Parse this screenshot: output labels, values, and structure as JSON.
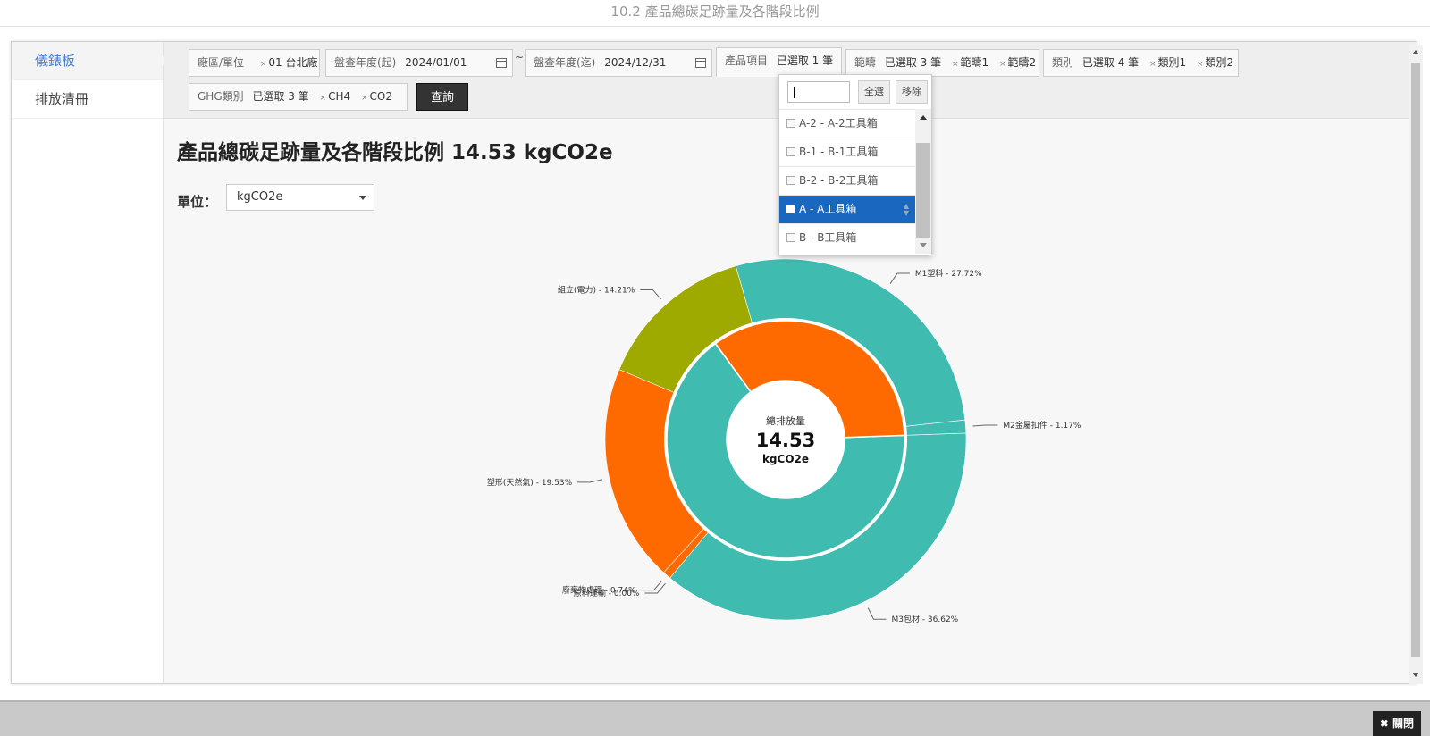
{
  "window": {
    "title": "10.2 產品總碳足跡量及各階段比例"
  },
  "sidebar": {
    "items": [
      {
        "label": "儀錶板"
      },
      {
        "label": "排放清冊"
      }
    ]
  },
  "filters": {
    "site": {
      "label": "廠區/單位",
      "chip": "01 台北廠"
    },
    "year_start": {
      "label": "盤查年度(起)",
      "value": "2024/01/01"
    },
    "tilde": "~",
    "year_end": {
      "label": "盤查年度(迄)",
      "value": "2024/12/31"
    },
    "product": {
      "label": "產品項目",
      "value": "已選取 1 筆"
    },
    "scope": {
      "label": "範疇",
      "value": "已選取 3 筆",
      "chips": [
        "範疇1",
        "範疇2"
      ]
    },
    "category": {
      "label": "類別",
      "value": "已選取 4 筆",
      "chips": [
        "類別1",
        "類別2"
      ]
    },
    "ghg": {
      "label": "GHG類別",
      "value": "已選取 3 筆",
      "chips": [
        "CH4",
        "CO2"
      ]
    },
    "chip_remove_glyph": "×",
    "query_button": "查詢"
  },
  "product_dropdown": {
    "search_value": "",
    "select_all": "全選",
    "remove": "移除",
    "items": [
      {
        "label": "A-2 - A-2工具箱",
        "checked": false
      },
      {
        "label": "B-1 - B-1工具箱",
        "checked": false
      },
      {
        "label": "B-2 - B-2工具箱",
        "checked": false
      },
      {
        "label": "A - A工具箱",
        "checked": true
      },
      {
        "label": "B - B工具箱",
        "checked": false
      }
    ]
  },
  "main": {
    "heading": "產品總碳足跡量及各階段比例 14.53 kgCO2e",
    "unit_label": "單位：",
    "unit_value": "kgCO2e"
  },
  "footer": {
    "close_label": "關閉",
    "close_icon": "✖"
  },
  "colors": {
    "teal": "#3fbbb0",
    "orange": "#ff6a00",
    "olive": "#9eaa00",
    "query_bg": "#333333",
    "selected_bg": "#1a67c0"
  },
  "chart_data": {
    "type": "pie",
    "center_label": "總排放量",
    "center_value": "14.53",
    "center_unit": "kgCO2e",
    "inner_ring": [
      {
        "name": "",
        "value": 65.51,
        "color": "#3fbbb0"
      },
      {
        "name": "",
        "value": 34.49,
        "color": "#ff6a00"
      }
    ],
    "outer_ring": [
      {
        "name": "M3包材",
        "pct": 36.62,
        "label": "M3包材 - 36.62%",
        "color": "#3fbbb0"
      },
      {
        "name": "原料運輸",
        "pct": 0.0,
        "label": "原料運輸 - 0.00%",
        "color": "#ff6a00"
      },
      {
        "name": "廢棄物處理",
        "pct": 0.74,
        "label": "廢棄物處理 - 0.74%",
        "color": "#ff6a00"
      },
      {
        "name": "塑形(天然氣)",
        "pct": 19.53,
        "label": "塑形(天然氣) - 19.53%",
        "color": "#ff6a00"
      },
      {
        "name": "組立(電力)",
        "pct": 14.21,
        "label": "組立(電力) - 14.21%",
        "color": "#9eaa00"
      },
      {
        "name": "M1塑料",
        "pct": 27.72,
        "label": "M1塑料 - 27.72%",
        "color": "#3fbbb0"
      },
      {
        "name": "M2金屬扣件",
        "pct": 1.17,
        "label": "M2金屬扣件 - 1.17%",
        "color": "#3fbbb0"
      }
    ]
  }
}
